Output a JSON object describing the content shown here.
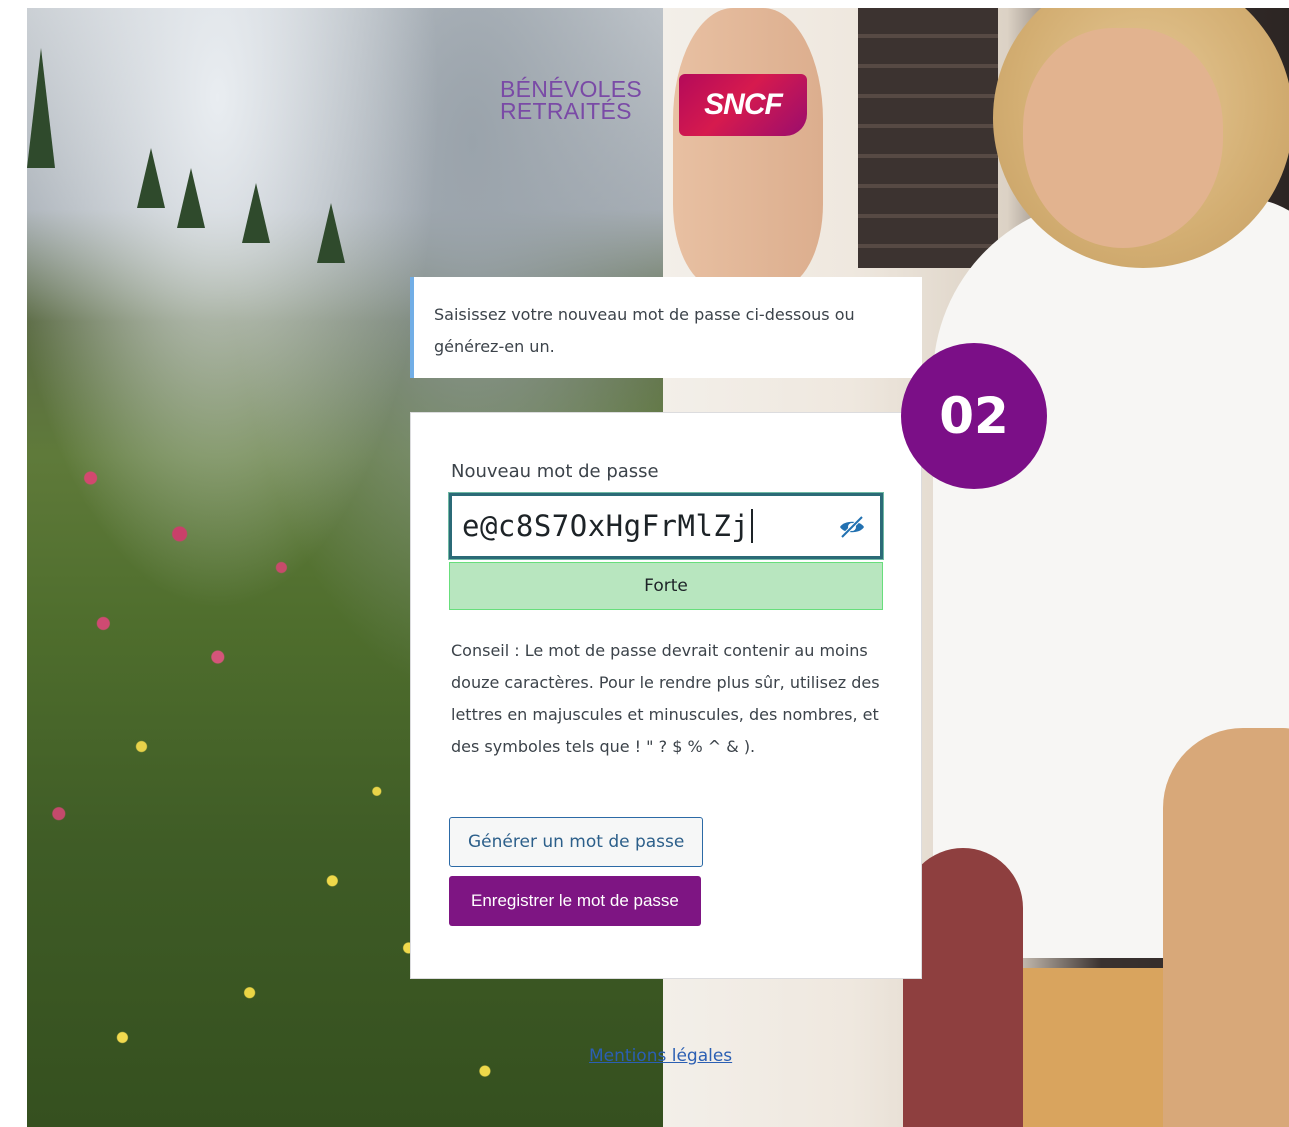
{
  "brand": {
    "line1": "BÉNÉVOLES",
    "line2": "RETRAITÉS",
    "badge": "SNCF",
    "accent_color": "#7e1583"
  },
  "message": {
    "text": "Saisissez votre nouveau mot de passe ci-dessous ou générez-en un."
  },
  "form": {
    "password_label": "Nouveau mot de passe",
    "password_value": "e@c8S7OxHgFrMlZj",
    "toggle_icon": "eye-slash-icon",
    "strength": "Forte",
    "hint": "Conseil : Le mot de passe devrait contenir au moins douze caractères. Pour le rendre plus sûr, utilisez des lettres en majuscules et minuscules, des nombres, et des symboles tels que ! \" ? $ % ^ & ).",
    "generate_button": "Générer un mot de passe",
    "save_button": "Enregistrer le mot de passe"
  },
  "step_badge": "02",
  "footer": {
    "legal_link": "Mentions légales"
  }
}
